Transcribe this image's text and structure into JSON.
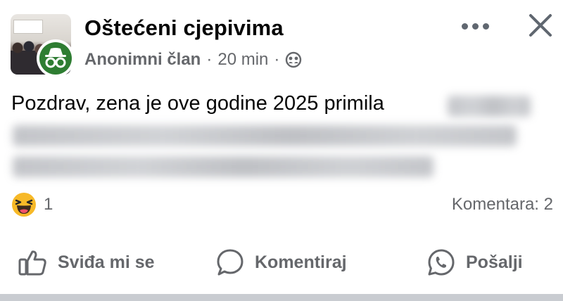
{
  "post": {
    "group_name": "Oštećeni cjepivima",
    "author": "Anonimni član",
    "separator": "·",
    "time": "20 min",
    "text_visible": "Pozdrav, zena je ove godine 2025 primila",
    "reaction_count": "1",
    "comments_label": "Komentara: 2"
  },
  "actions": {
    "like": "Sviđa mi se",
    "comment": "Komentiraj",
    "share": "Pošalji"
  },
  "icons": {
    "more": "more-options-icon",
    "close": "close-icon",
    "privacy": "group-privacy-icon",
    "anonymous": "anonymous-member-icon",
    "reaction": "haha-reaction-icon",
    "like": "thumbs-up-icon",
    "comment": "comment-bubble-icon",
    "share": "whatsapp-icon"
  },
  "colors": {
    "anonymous_badge": "#2e7d32",
    "secondary_text": "#65676b",
    "primary_text": "#050505"
  }
}
